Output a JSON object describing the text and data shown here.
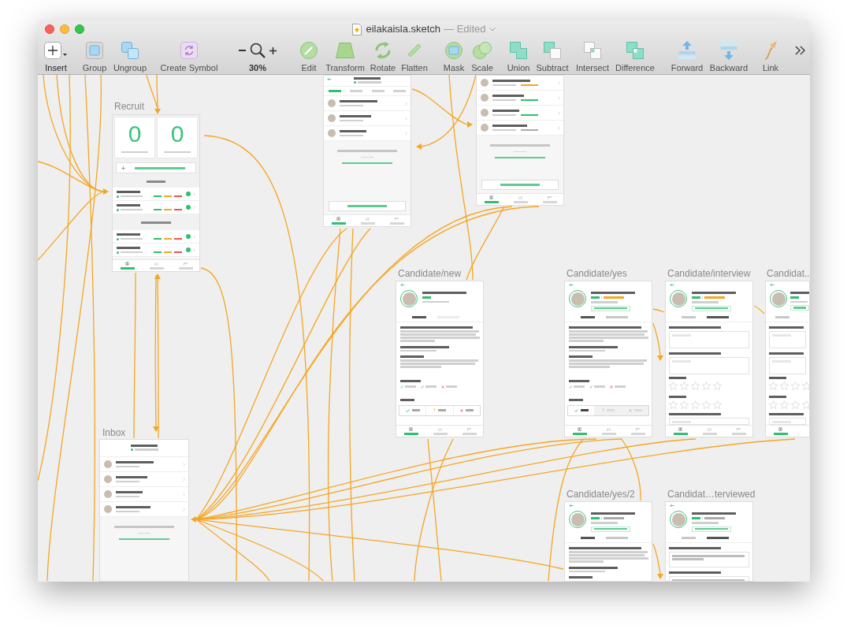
{
  "window": {
    "title": "eilakaisla.sketch",
    "status": "— Edited"
  },
  "toolbar": [
    {
      "kind": "insert",
      "label": "Insert"
    },
    {
      "kind": "group",
      "label": "Group"
    },
    {
      "kind": "ungroup",
      "label": "Ungroup"
    },
    {
      "kind": "symbol",
      "label": "Create Symbol"
    },
    {
      "kind": "zoom",
      "label": "30%"
    },
    {
      "kind": "edit",
      "label": "Edit"
    },
    {
      "kind": "transform",
      "label": "Transform"
    },
    {
      "kind": "rotate",
      "label": "Rotate"
    },
    {
      "kind": "flatten",
      "label": "Flatten"
    },
    {
      "kind": "mask",
      "label": "Mask"
    },
    {
      "kind": "scale",
      "label": "Scale"
    },
    {
      "kind": "union",
      "label": "Union"
    },
    {
      "kind": "subtract",
      "label": "Subtract"
    },
    {
      "kind": "intersect",
      "label": "Intersect"
    },
    {
      "kind": "difference",
      "label": "Difference"
    },
    {
      "kind": "forward",
      "label": "Forward"
    },
    {
      "kind": "backward",
      "label": "Backward"
    },
    {
      "kind": "link",
      "label": "Link"
    },
    {
      "kind": "more"
    }
  ],
  "artboards": [
    {
      "label": "Recruit",
      "blocks": [
        {
          "kind": "stat_cards",
          "cards": [
            {
              "value": "0"
            },
            {
              "value": "0"
            }
          ]
        },
        {
          "kind": "create_button"
        },
        {
          "kind": "section"
        },
        {
          "kind": "job_row",
          "stats": [
            {
              "color": "#2fbf71"
            },
            {
              "color": "#f5a623"
            },
            {
              "color": "#e8564a"
            }
          ]
        },
        {
          "kind": "job_row",
          "stats": [
            {
              "color": "#2fbf71"
            },
            {
              "color": "#f5a623"
            },
            {
              "color": "#e8564a"
            }
          ]
        },
        {
          "kind": "section"
        },
        {
          "kind": "job_row",
          "stats": [
            {
              "color": "#2fbf71"
            },
            {
              "color": "#f5a623"
            },
            {
              "color": "#e8564a"
            }
          ]
        },
        {
          "kind": "job_row",
          "stats": [
            {
              "color": "#2fbf71"
            },
            {
              "color": "#f5a623"
            },
            {
              "color": "#e8564a"
            }
          ]
        },
        {
          "kind": "tab_bar",
          "items": [
            {
              "selected": true
            },
            {
              "selected": false
            },
            {
              "selected": false
            }
          ]
        }
      ]
    },
    {
      "blocks": [
        {
          "kind": "job_header",
          "back": true
        },
        {
          "kind": "filter_tabs",
          "items": [
            {
              "selected": true
            },
            {
              "selected": false
            },
            {
              "selected": false
            },
            {
              "selected": false
            }
          ]
        },
        {
          "kind": "candidate_row"
        },
        {
          "kind": "candidate_row"
        },
        {
          "kind": "candidate_row"
        },
        {
          "kind": "hint"
        },
        {
          "kind": "link"
        },
        {
          "kind": "primary_button"
        },
        {
          "kind": "tab_bar",
          "items": [
            {
              "selected": true
            },
            {
              "selected": false
            },
            {
              "selected": false
            }
          ]
        }
      ]
    },
    {
      "blocks": [
        {
          "kind": "candidate_row",
          "status": {
            "color": "#f5a623"
          }
        },
        {
          "kind": "candidate_row",
          "status": {
            "color": "#2fbf71"
          }
        },
        {
          "kind": "candidate_row",
          "status": {
            "color": "#2fbf71"
          }
        },
        {
          "kind": "candidate_row",
          "status": {
            "color": "#aaaaaa"
          }
        },
        {
          "kind": "hint"
        },
        {
          "kind": "link"
        },
        {
          "kind": "primary_button"
        },
        {
          "kind": "tab_bar",
          "items": [
            {
              "selected": true
            },
            {
              "selected": false
            },
            {
              "selected": false
            }
          ]
        }
      ]
    },
    {
      "label": "Candidate/new",
      "blocks": [
        {
          "kind": "back"
        },
        {
          "kind": "profile",
          "status": [
            {
              "color": "#2fbf71"
            }
          ]
        },
        {
          "kind": "doc_tabs",
          "items": [
            {
              "selected": true,
              "disabled": false
            },
            {
              "selected": false,
              "disabled": true
            }
          ]
        },
        {
          "kind": "question"
        },
        {
          "kind": "paragraph"
        },
        {
          "kind": "question"
        },
        {
          "kind": "phrase"
        },
        {
          "kind": "question"
        },
        {
          "kind": "passage"
        },
        {
          "kind": "heading"
        },
        {
          "kind": "languages",
          "items": [
            {
              "known": true
            },
            {
              "known": true
            },
            {
              "known": false
            }
          ]
        },
        {
          "kind": "heading"
        },
        {
          "kind": "decision_bar",
          "buttons": [
            {
              "kind": "yes",
              "selected": false
            },
            {
              "kind": "maybe",
              "selected": false
            },
            {
              "kind": "no",
              "selected": false
            }
          ]
        },
        {
          "kind": "tab_bar",
          "items": [
            {
              "selected": true
            },
            {
              "selected": false
            },
            {
              "selected": false
            }
          ]
        }
      ]
    },
    {
      "label": "Candidate/yes",
      "blocks": [
        {
          "kind": "back"
        },
        {
          "kind": "profile",
          "status": [
            {
              "color": "#2fbf71"
            },
            {
              "color": "#f5a623"
            }
          ],
          "schedule_button": true
        },
        {
          "kind": "doc_tabs",
          "items": [
            {
              "selected": true,
              "disabled": false
            },
            {
              "selected": false,
              "disabled": false
            }
          ]
        },
        {
          "kind": "question"
        },
        {
          "kind": "paragraph"
        },
        {
          "kind": "question"
        },
        {
          "kind": "phrase"
        },
        {
          "kind": "question"
        },
        {
          "kind": "passage"
        },
        {
          "kind": "heading"
        },
        {
          "kind": "languages",
          "items": [
            {
              "known": true
            },
            {
              "known": true
            },
            {
              "known": false
            }
          ]
        },
        {
          "kind": "heading"
        },
        {
          "kind": "decision_bar",
          "buttons": [
            {
              "kind": "yes",
              "selected": true
            },
            {
              "kind": "maybe",
              "selected": false
            },
            {
              "kind": "no",
              "selected": false
            }
          ]
        },
        {
          "kind": "tab_bar",
          "items": [
            {
              "selected": true
            },
            {
              "selected": false
            },
            {
              "selected": false
            }
          ]
        }
      ]
    },
    {
      "label": "Candidate/interview",
      "blocks": [
        {
          "kind": "back"
        },
        {
          "kind": "profile",
          "status": [
            {
              "color": "#2fbf71"
            },
            {
              "color": "#f5a623"
            }
          ],
          "schedule_button": true
        },
        {
          "kind": "doc_tabs",
          "items": [
            {
              "selected": false,
              "disabled": false
            },
            {
              "selected": true,
              "disabled": false
            }
          ]
        },
        {
          "kind": "note_field",
          "answered": false
        },
        {
          "kind": "note_field",
          "answered": false
        },
        {
          "kind": "rating",
          "stars": 0
        },
        {
          "kind": "rating",
          "stars": 0
        },
        {
          "kind": "note_field",
          "answered": false
        },
        {
          "kind": "tab_bar",
          "items": [
            {
              "selected": true
            },
            {
              "selected": false
            },
            {
              "selected": false
            }
          ]
        }
      ]
    },
    {
      "label": "Candidat..",
      "blocks": [
        {
          "kind": "back"
        },
        {
          "kind": "profile",
          "status": [
            {
              "color": "#2fbf71"
            }
          ],
          "schedule_button": true
        },
        {
          "kind": "doc_tabs",
          "items": [
            {
              "selected": false,
              "disabled": false
            }
          ]
        },
        {
          "kind": "note_field",
          "answered": false
        },
        {
          "kind": "note_field",
          "answered": false
        },
        {
          "kind": "rating",
          "stars": 0
        },
        {
          "kind": "rating",
          "stars": 0
        },
        {
          "kind": "note_field",
          "answered": false
        },
        {
          "kind": "tab_bar",
          "items": [
            {
              "selected": true
            }
          ]
        }
      ]
    },
    {
      "label": "Inbox",
      "blocks": [
        {
          "kind": "job_header"
        },
        {
          "kind": "candidate_row"
        },
        {
          "kind": "candidate_row"
        },
        {
          "kind": "candidate_row"
        },
        {
          "kind": "candidate_row"
        },
        {
          "kind": "hint"
        },
        {
          "kind": "link"
        }
      ]
    },
    {
      "label": "Candidate/yes/2",
      "blocks": [
        {
          "kind": "back"
        },
        {
          "kind": "profile",
          "status": [
            {
              "color": "#2fbf71"
            },
            {
              "color": "#aaaaaa"
            }
          ],
          "schedule_button": true
        },
        {
          "kind": "doc_tabs",
          "items": [
            {
              "selected": true,
              "disabled": false
            },
            {
              "selected": false,
              "disabled": false
            }
          ]
        },
        {
          "kind": "question"
        },
        {
          "kind": "paragraph"
        },
        {
          "kind": "question"
        },
        {
          "kind": "phrase"
        },
        {
          "kind": "question"
        }
      ]
    },
    {
      "label": "Candidat…terviewed",
      "blocks": [
        {
          "kind": "back"
        },
        {
          "kind": "profile",
          "status": [
            {
              "color": "#2fbf71"
            },
            {
              "color": "#aaaaaa"
            }
          ],
          "schedule_button": true
        },
        {
          "kind": "doc_tabs",
          "items": [
            {
              "selected": false,
              "disabled": false
            },
            {
              "selected": true,
              "disabled": false
            }
          ]
        },
        {
          "kind": "note_field",
          "answered": true
        },
        {
          "kind": "note_field",
          "answered": true
        }
      ]
    }
  ]
}
